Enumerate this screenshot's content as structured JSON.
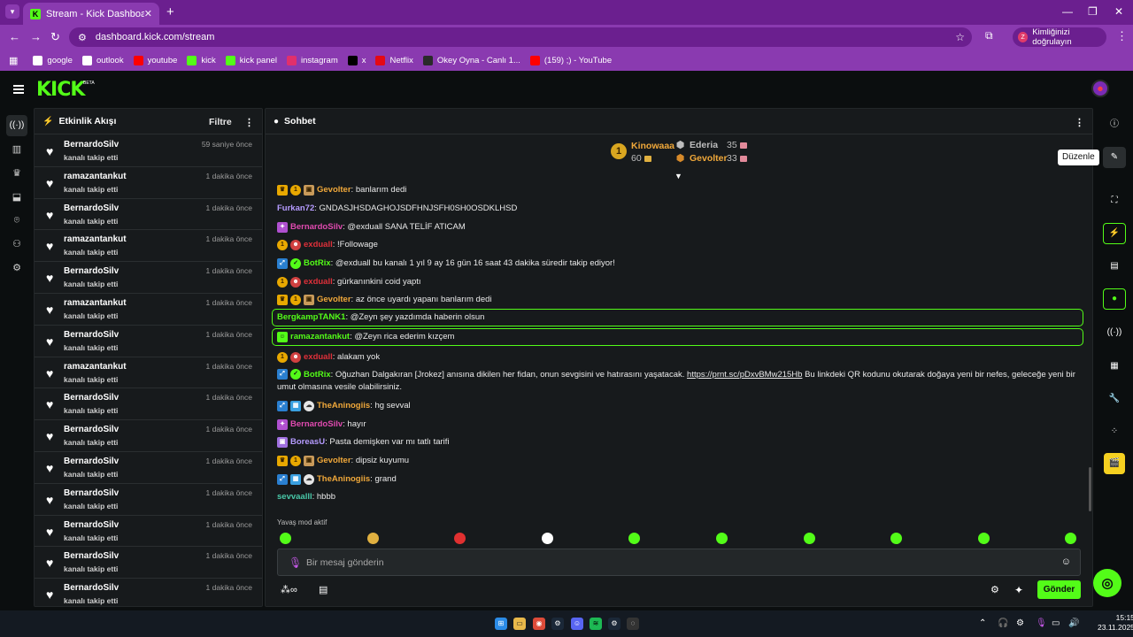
{
  "browser": {
    "tab_title": "Stream - Kick Dashboard",
    "url": "dashboard.kick.com/stream",
    "verify_label": "Kimliğinizi doğrulayın",
    "verify_avatar": "Z",
    "bookmarks": [
      {
        "label": "google",
        "icon": "google-icon",
        "color": "#ffffff"
      },
      {
        "label": "outlook",
        "icon": "outlook-icon",
        "color": "#ffffff"
      },
      {
        "label": "youtube",
        "icon": "youtube-icon",
        "color": "#ff0000"
      },
      {
        "label": "kick",
        "icon": "kick-icon",
        "color": "#53fc18"
      },
      {
        "label": "kick panel",
        "icon": "kick-icon",
        "color": "#53fc18"
      },
      {
        "label": "instagram",
        "icon": "instagram-icon",
        "color": "#e1306c"
      },
      {
        "label": "x",
        "icon": "x-icon",
        "color": "#000000"
      },
      {
        "label": "Netflix",
        "icon": "netflix-icon",
        "color": "#e50914"
      },
      {
        "label": "Okey Oyna - Canlı 1...",
        "icon": "okey-icon",
        "color": "#2a2a2a"
      },
      {
        "label": "(159) ;) - YouTube",
        "icon": "youtube-icon",
        "color": "#ff0000"
      }
    ]
  },
  "app": {
    "logo": "KICK",
    "logo_badge": "BETA",
    "accent": "#53fc18"
  },
  "activity": {
    "title": "Etkinlik Akışı",
    "filter_label": "Filtre",
    "items": [
      {
        "name": "BernardoSilv",
        "action": "kanalı takip etti",
        "time": "59 saniye önce"
      },
      {
        "name": "ramazantankut",
        "action": "kanalı takip etti",
        "time": "1 dakika önce"
      },
      {
        "name": "BernardoSilv",
        "action": "kanalı takip etti",
        "time": "1 dakika önce"
      },
      {
        "name": "ramazantankut",
        "action": "kanalı takip etti",
        "time": "1 dakika önce"
      },
      {
        "name": "BernardoSilv",
        "action": "kanalı takip etti",
        "time": "1 dakika önce"
      },
      {
        "name": "ramazantankut",
        "action": "kanalı takip etti",
        "time": "1 dakika önce"
      },
      {
        "name": "BernardoSilv",
        "action": "kanalı takip etti",
        "time": "1 dakika önce"
      },
      {
        "name": "ramazantankut",
        "action": "kanalı takip etti",
        "time": "1 dakika önce"
      },
      {
        "name": "BernardoSilv",
        "action": "kanalı takip etti",
        "time": "1 dakika önce"
      },
      {
        "name": "BernardoSilv",
        "action": "kanalı takip etti",
        "time": "1 dakika önce"
      },
      {
        "name": "BernardoSilv",
        "action": "kanalı takip etti",
        "time": "1 dakika önce"
      },
      {
        "name": "BernardoSilv",
        "action": "kanalı takip etti",
        "time": "1 dakika önce"
      },
      {
        "name": "BernardoSilv",
        "action": "kanalı takip etti",
        "time": "1 dakika önce"
      },
      {
        "name": "BernardoSilv",
        "action": "kanalı takip etti",
        "time": "1 dakika önce"
      },
      {
        "name": "BernardoSilv",
        "action": "kanalı takip etti",
        "time": "1 dakika önce"
      }
    ]
  },
  "chat": {
    "title": "Sohbet",
    "leaderboard": {
      "first": {
        "rank": "1",
        "name": "Kinowaaa",
        "score": "60"
      },
      "second": {
        "name": "Ederia",
        "score": "35"
      },
      "third": {
        "name": "Gevolter",
        "score": "33"
      }
    },
    "messages": [
      {
        "badges": [
          "crown",
          "one",
          "gift"
        ],
        "user": "Gevolter",
        "color": "orange",
        "text": ": banlarım dedi"
      },
      {
        "badges": [],
        "user": "Furkan72",
        "color": "purple",
        "text": ": GNDASJHSDAGHOJSDFHNJSFH0SH0OSDKLHSD"
      },
      {
        "badges": [
          "pink"
        ],
        "user": "BernardoSilv",
        "color": "pink",
        "text": ": @exduall SANA TELİF ATICAM"
      },
      {
        "badges": [
          "one",
          "dev"
        ],
        "user": "exduall",
        "color": "red",
        "text": ": !Followage"
      },
      {
        "badges": [
          "bot",
          "ver"
        ],
        "user": "BotRix",
        "color": "green",
        "text": ": @exduall bu kanalı 1 yıl 9 ay 16 gün 16 saat 43 dakika süredir takip ediyor!"
      },
      {
        "badges": [
          "one",
          "dev"
        ],
        "user": "exduall",
        "color": "red",
        "text": ": gürkanınkini coid yaptı"
      },
      {
        "badges": [
          "crown",
          "one",
          "gift"
        ],
        "user": "Gevolter",
        "color": "orange",
        "text": ": az önce uyardı yapanı banlarım dedi"
      },
      {
        "badges": [],
        "user": "BergkampTANK1",
        "color": "green",
        "text": ": @Zeyn şey yazdımda haberin olsun",
        "highlight": true
      },
      {
        "badges": [
          "green"
        ],
        "user": "ramazantankut",
        "color": "green",
        "text": ": @Zeyn rica ederim kızçem",
        "highlight": true
      },
      {
        "badges": [
          "one",
          "dev"
        ],
        "user": "exduall",
        "color": "red",
        "text": ": alakam yok"
      },
      {
        "badges": [
          "bot",
          "ver"
        ],
        "user": "BotRix",
        "color": "green",
        "text": ": Oğuzhan Dalgakıran [Jrokez] anısına dikilen her fidan, onun sevgisini ve hatırasını yaşatacak.",
        "link": "https://prnt.sc/pDxvBMw215Hb",
        "text2": " Bu linkdeki QR kodunu okutarak doğaya yeni bir nefes, geleceğe yeni bir umut olmasına vesile olabilirsiniz."
      },
      {
        "badges": [
          "bot",
          "grid",
          "cloud"
        ],
        "user": "TheAninogiis",
        "color": "orange",
        "text": ": hg sevval"
      },
      {
        "badges": [
          "pink"
        ],
        "user": "BernardoSilv",
        "color": "pink",
        "text": ": hayır"
      },
      {
        "badges": [
          "purple"
        ],
        "user": "BoreasU",
        "color": "purple",
        "text": ": Pasta demişken var mı tatlı tarifi"
      },
      {
        "badges": [
          "crown",
          "one",
          "gift"
        ],
        "user": "Gevolter",
        "color": "orange",
        "text": ": dipsiz kuyumu"
      },
      {
        "badges": [
          "bot",
          "grid",
          "cloud"
        ],
        "user": "TheAninogiis",
        "color": "orange",
        "text": ": grand"
      },
      {
        "badges": [],
        "user": "sevvaalll",
        "color": "teal",
        "text": ": hbbb"
      }
    ],
    "slow_mode": "Yavaş mod aktif",
    "input_placeholder": "Bir mesaj gönderin",
    "send_label": "Gönder",
    "emote_colors": [
      "#53fc18",
      "#e0b040",
      "#e03030",
      "#ffffff",
      "#53fc18",
      "#53fc18",
      "#53fc18",
      "#53fc18",
      "#53fc18",
      "#53fc18"
    ]
  },
  "right_rail": {
    "tooltip": "Düzenle"
  },
  "taskbar": {
    "time": "15:15",
    "date": "23.11.2025"
  }
}
